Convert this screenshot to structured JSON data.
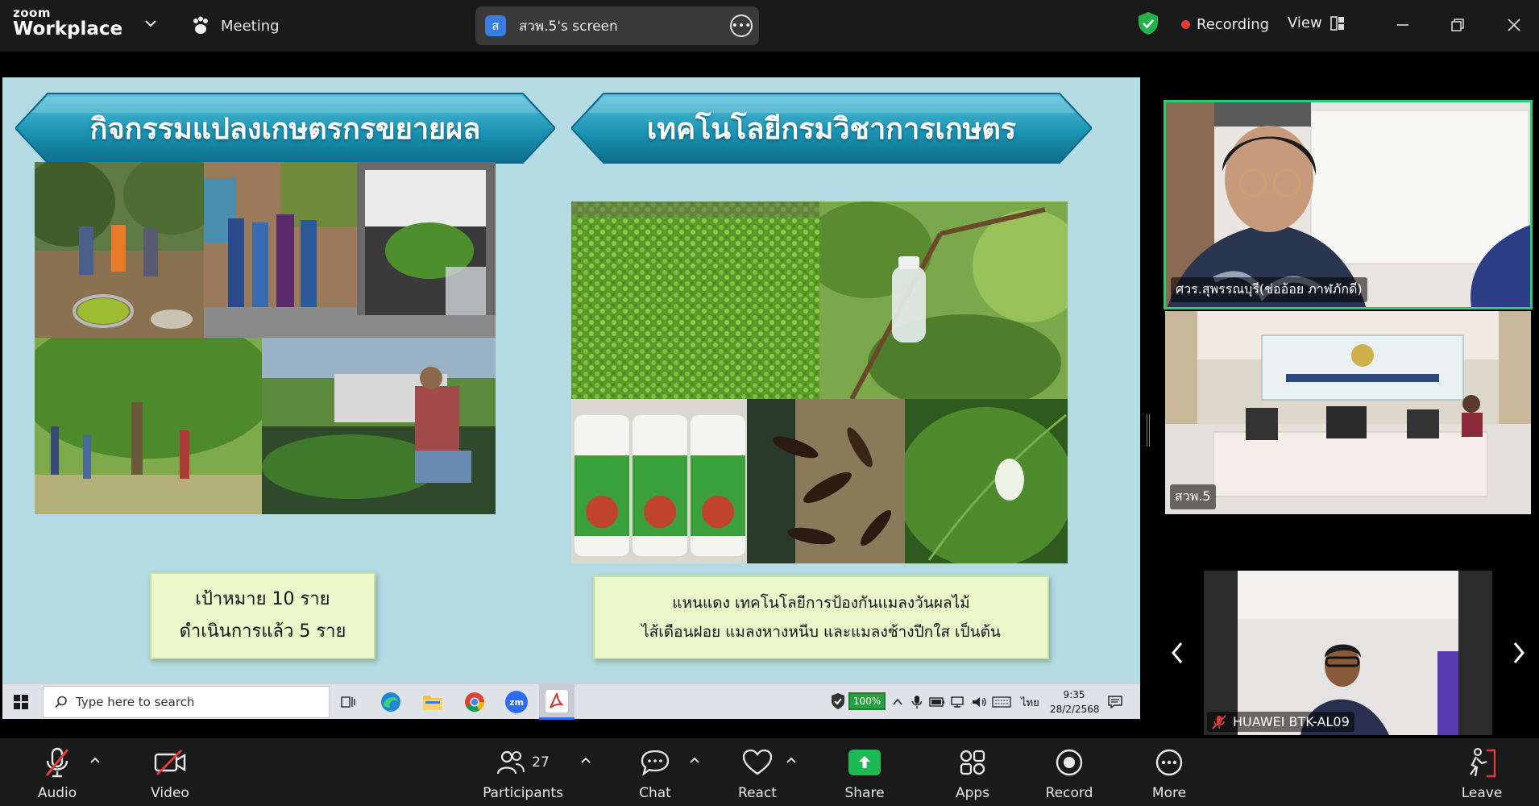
{
  "app": {
    "logo_small": "zoom",
    "logo_big": "Workplace",
    "meeting_label": "Meeting",
    "share_badge": "ส",
    "share_label": "สวพ.5's screen",
    "recording_label": "Recording",
    "view_label": "View"
  },
  "slide": {
    "banner_left": "กิจกรรมแปลงเกษตรกรขยายผล",
    "banner_right": "เทคโนโลยีกรมวิชาการเกษตร",
    "caption_left_line1": "เป้าหมาย 10 ราย",
    "caption_left_line2": "ดำเนินการแล้ว 5 ราย",
    "caption_right_line1": "แหนแดง เทคโนโลยีการป้องกันแมลงวันผลไม้",
    "caption_right_line2": "ไส้เดือนฝอย แมลงหางหนีบ และแมลงช้างปีกใส เป็นต้น"
  },
  "taskbar": {
    "search_placeholder": "Type here to search",
    "zoom_icon": "zm",
    "battery": "100%",
    "lang": "ไทย",
    "time": "9:35",
    "date": "28/2/2568"
  },
  "videos": {
    "tile1_name": "ศวร.สุพรรณบุรี(ช่ออ้อย ภาฬภักดี)",
    "tile2_name": "สวพ.5",
    "tile3_name": "HUAWEI BTK-AL09"
  },
  "toolbar": {
    "audio": "Audio",
    "video": "Video",
    "participants": "Participants",
    "participants_count": "27",
    "chat": "Chat",
    "react": "React",
    "share": "Share",
    "apps": "Apps",
    "record": "Record",
    "more": "More",
    "leave": "Leave"
  },
  "colors": {
    "topbar": "#1a1a1a",
    "slide_bg": "#b4dbe3",
    "banner": "#1e96b6",
    "share_green": "#1db954",
    "active_speaker": "#2ecc71",
    "recording_red": "#e53935"
  }
}
